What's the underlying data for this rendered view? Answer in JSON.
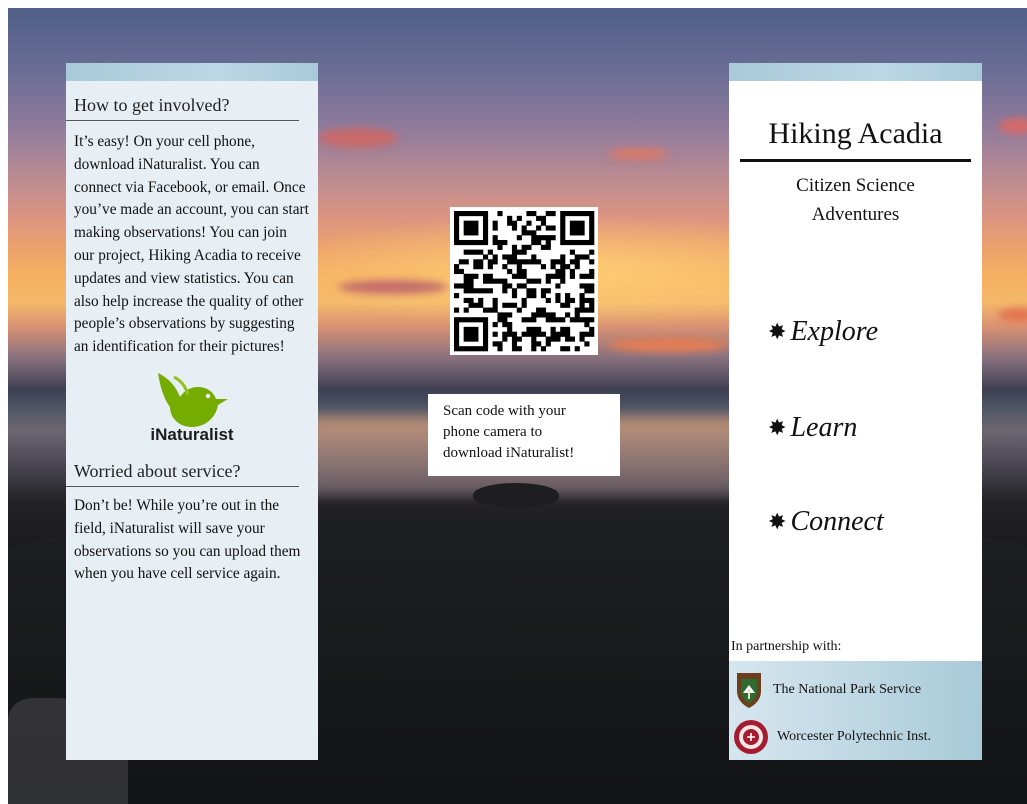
{
  "left_panel": {
    "heading1": "How to get involved?",
    "body1": "It’s easy! On your cell phone, download iNaturalist. You can connect via Facebook, or email. Once you’ve made an account, you can start making observations! You can join our project, Hiking Acadia to receive updates and view statistics. You can also help increase the quality of other people’s observations by suggesting an identification for their pictures!",
    "logo_text": "iNaturalist",
    "heading2": "Worried about service?",
    "body2": "Don’t be! While you’re out in the field, iNaturalist will save your observations so you can upload them when you have cell service again."
  },
  "center": {
    "caption_line1": "Scan code with your",
    "caption_line2": "phone camera to",
    "caption_line3": "download iNaturalist!"
  },
  "right_panel": {
    "title": "Hiking Acadia",
    "subtitle_line1": "Citizen Science",
    "subtitle_line2": "Adventures",
    "verbs": [
      "Explore",
      "Learn",
      "Connect"
    ],
    "partnership_label": "In partnership with:",
    "partners": [
      "The National Park Service",
      "Worcester Polytechnic Inst."
    ]
  },
  "colors": {
    "panel_blue": "#a9cad9",
    "left_panel_bg": "#e7eff5",
    "inat_green": "#74ac00"
  },
  "icons": {
    "verb_icon": "star-burst-icon",
    "logo": "bird-icon"
  }
}
